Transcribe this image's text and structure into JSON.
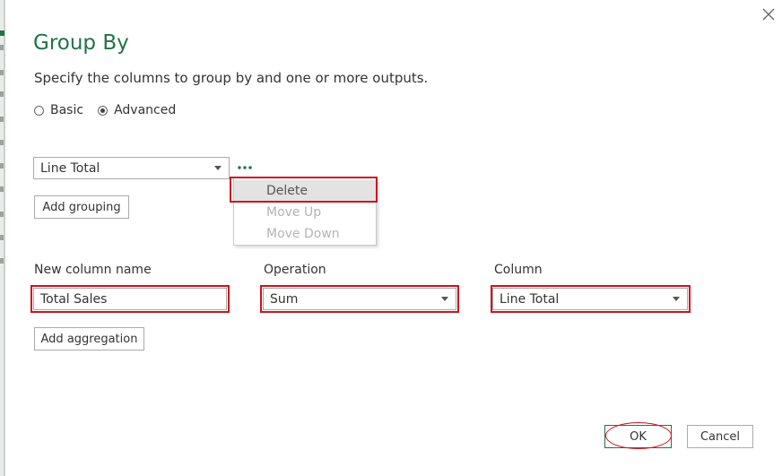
{
  "dialog": {
    "title": "Group By",
    "subtitle": "Specify the columns to group by and one or more outputs."
  },
  "mode": {
    "options": [
      {
        "label": "Basic",
        "selected": false
      },
      {
        "label": "Advanced",
        "selected": true
      }
    ]
  },
  "grouping": {
    "selected_column": "Line Total",
    "add_label": "Add grouping",
    "context_menu": {
      "items": [
        {
          "label": "Delete",
          "enabled": true,
          "hovered": true
        },
        {
          "label": "Move Up",
          "enabled": false
        },
        {
          "label": "Move Down",
          "enabled": false
        }
      ]
    }
  },
  "aggregation": {
    "headers": {
      "new_column_name": "New column name",
      "operation": "Operation",
      "column": "Column"
    },
    "rows": [
      {
        "new_column_name": "Total Sales",
        "operation": "Sum",
        "column": "Line Total"
      }
    ],
    "add_label": "Add aggregation"
  },
  "footer": {
    "ok_label": "OK",
    "cancel_label": "Cancel"
  },
  "colors": {
    "accent": "#217346",
    "annotation": "#d0121b"
  },
  "icons": [
    "close-icon",
    "ellipsis-icon",
    "chevron-down-icon"
  ]
}
